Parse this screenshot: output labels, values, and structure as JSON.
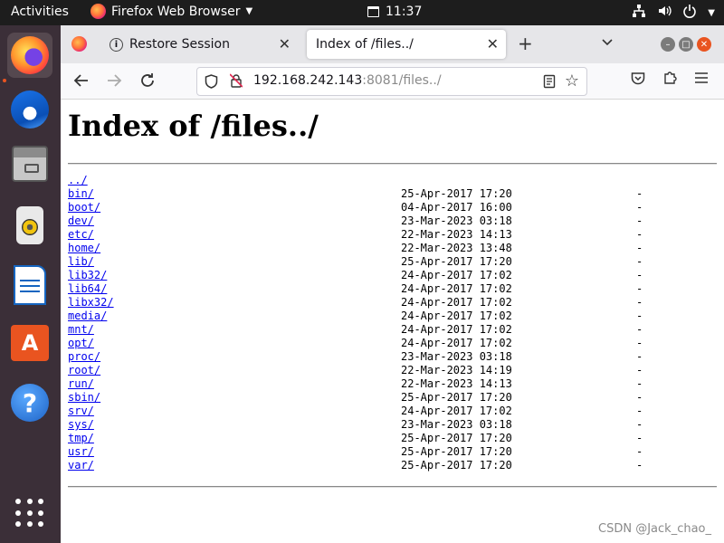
{
  "topbar": {
    "activities": "Activities",
    "app_name": "Firefox Web Browser",
    "time": "11:37"
  },
  "browser": {
    "tabs": [
      {
        "label": "Restore Session"
      },
      {
        "label": "Index of /files../"
      }
    ],
    "url": {
      "host": "192.168.242.143",
      "rest": ":8081/files../"
    }
  },
  "page": {
    "title": "Index of /files../",
    "parent_link": "../",
    "entries": [
      {
        "name": "bin/",
        "date": "25-Apr-2017 17:20",
        "size": "-"
      },
      {
        "name": "boot/",
        "date": "04-Apr-2017 16:00",
        "size": "-"
      },
      {
        "name": "dev/",
        "date": "23-Mar-2023 03:18",
        "size": "-"
      },
      {
        "name": "etc/",
        "date": "22-Mar-2023 14:13",
        "size": "-"
      },
      {
        "name": "home/",
        "date": "22-Mar-2023 13:48",
        "size": "-"
      },
      {
        "name": "lib/",
        "date": "25-Apr-2017 17:20",
        "size": "-"
      },
      {
        "name": "lib32/",
        "date": "24-Apr-2017 17:02",
        "size": "-"
      },
      {
        "name": "lib64/",
        "date": "24-Apr-2017 17:02",
        "size": "-"
      },
      {
        "name": "libx32/",
        "date": "24-Apr-2017 17:02",
        "size": "-"
      },
      {
        "name": "media/",
        "date": "24-Apr-2017 17:02",
        "size": "-"
      },
      {
        "name": "mnt/",
        "date": "24-Apr-2017 17:02",
        "size": "-"
      },
      {
        "name": "opt/",
        "date": "24-Apr-2017 17:02",
        "size": "-"
      },
      {
        "name": "proc/",
        "date": "23-Mar-2023 03:18",
        "size": "-"
      },
      {
        "name": "root/",
        "date": "22-Mar-2023 14:19",
        "size": "-"
      },
      {
        "name": "run/",
        "date": "22-Mar-2023 14:13",
        "size": "-"
      },
      {
        "name": "sbin/",
        "date": "25-Apr-2017 17:20",
        "size": "-"
      },
      {
        "name": "srv/",
        "date": "24-Apr-2017 17:02",
        "size": "-"
      },
      {
        "name": "sys/",
        "date": "23-Mar-2023 03:18",
        "size": "-"
      },
      {
        "name": "tmp/",
        "date": "25-Apr-2017 17:20",
        "size": "-"
      },
      {
        "name": "usr/",
        "date": "25-Apr-2017 17:20",
        "size": "-"
      },
      {
        "name": "var/",
        "date": "25-Apr-2017 17:20",
        "size": "-"
      }
    ]
  },
  "watermark": "CSDN @Jack_chao_",
  "icons": {
    "dock": [
      "firefox-icon",
      "thunderbird-icon",
      "files-icon",
      "rhythmbox-icon",
      "libreoffice-writer-icon",
      "ubuntu-software-icon",
      "help-icon",
      "show-applications-icon"
    ]
  },
  "colors": {
    "accent": "#e95420",
    "link": "#0000ee",
    "dock_bg": "#3b2f38",
    "topbar_bg": "#1d1d1d"
  }
}
